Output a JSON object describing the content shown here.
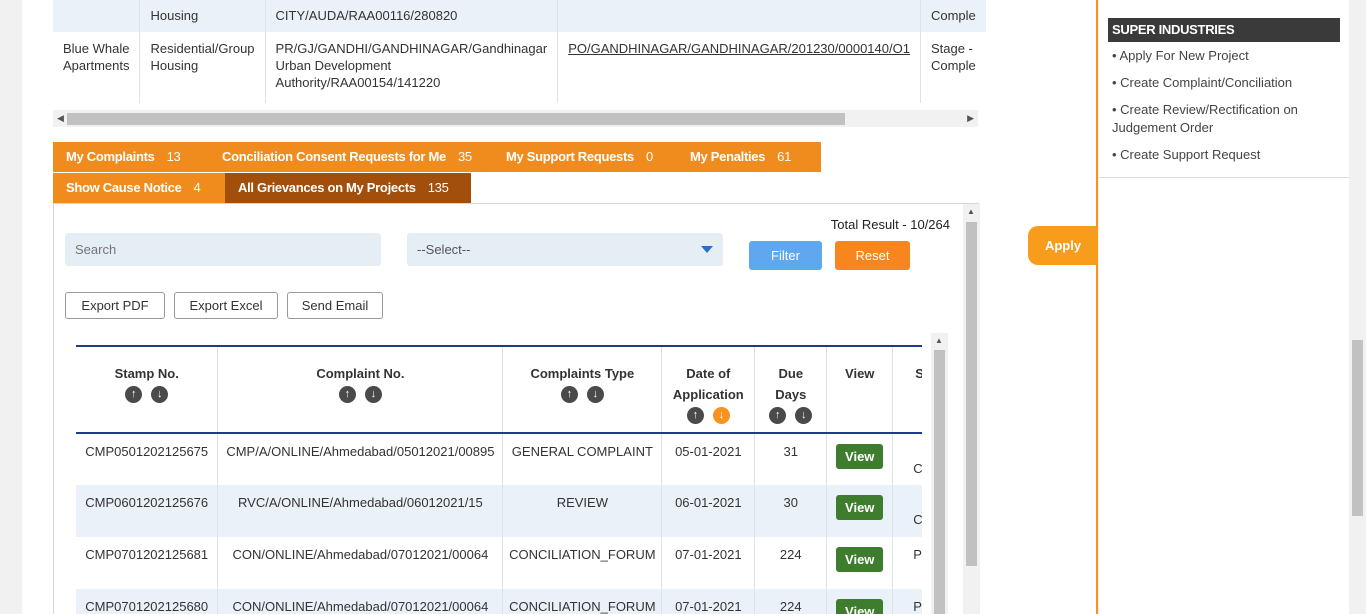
{
  "projects": [
    {
      "name": "",
      "type": "Housing",
      "reg": "CITY/AUDA/RAA00116/280820",
      "po": "",
      "status": "Comple"
    },
    {
      "name": "Blue Whale Apartments",
      "type": "Residential/Group Housing",
      "reg": "PR/GJ/GANDHI/GANDHINAGAR/Gandhinagar Urban Development Authority/RAA00154/141220",
      "po": "PO/GANDHINAGAR/GANDHINAGAR/201230/0000140/O1",
      "status": "Stage - Comple"
    }
  ],
  "tabs": [
    {
      "label": "My Complaints",
      "count": "13"
    },
    {
      "label": "Conciliation Consent Requests for Me",
      "count": "35"
    },
    {
      "label": "My Support Requests",
      "count": "0"
    },
    {
      "label": "My Penalties",
      "count": "61"
    },
    {
      "label": "Show Cause Notice",
      "count": "4"
    },
    {
      "label": "All Grievances on My Projects",
      "count": "135"
    }
  ],
  "filters": {
    "total_result": "Total Result - 10/264",
    "search_placeholder": "Search",
    "select_value": "--Select--",
    "filter_label": "Filter",
    "reset_label": "Reset"
  },
  "exports": {
    "pdf": "Export PDF",
    "excel": "Export Excel",
    "email": "Send Email"
  },
  "grid": {
    "headers": {
      "stamp": "Stamp No.",
      "complaint": "Complaint No.",
      "type": "Complaints Type",
      "date": "Date of Application",
      "due": "Due Days",
      "view": "View",
      "status": "S"
    },
    "rows": [
      {
        "stamp": "CMP0501202125675",
        "complaint": "CMP/A/ONLINE/Ahmedabad/05012021/00895",
        "type": "GENERAL COMPLAINT",
        "date": "05-01-2021",
        "due": "31",
        "view": "View",
        "status": "C"
      },
      {
        "stamp": "CMP0601202125676",
        "complaint": "RVC/A/ONLINE/Ahmedabad/06012021/15",
        "type": "REVIEW",
        "date": "06-01-2021",
        "due": "30",
        "view": "View",
        "status": "C"
      },
      {
        "stamp": "CMP0701202125681",
        "complaint": "CON/ONLINE/Ahmedabad/07012021/00064",
        "type": "CONCILIATION_FORUM",
        "date": "07-01-2021",
        "due": "224",
        "view": "View",
        "status": "Pe Sc"
      },
      {
        "stamp": "CMP0701202125680",
        "complaint": "CON/ONLINE/Ahmedabad/07012021/00064",
        "type": "CONCILIATION_FORUM",
        "date": "07-01-2021",
        "due": "224",
        "view": "View",
        "status": "Pe"
      }
    ]
  },
  "apply_label": "Apply",
  "sidebar": {
    "title": "SUPER INDUSTRIES",
    "items": [
      "• Apply For New Project",
      "• Create Complaint/Conciliation",
      "• Create Review/Rectification on Judgement Order",
      "• Create Support Request"
    ]
  },
  "colors": {
    "tab": "#f08c1e",
    "tab_active": "#a24e0c",
    "filter": "#5fa8f0",
    "reset": "#f7861f",
    "view": "#3f7d2e",
    "header_rule": "#1f3c88"
  }
}
